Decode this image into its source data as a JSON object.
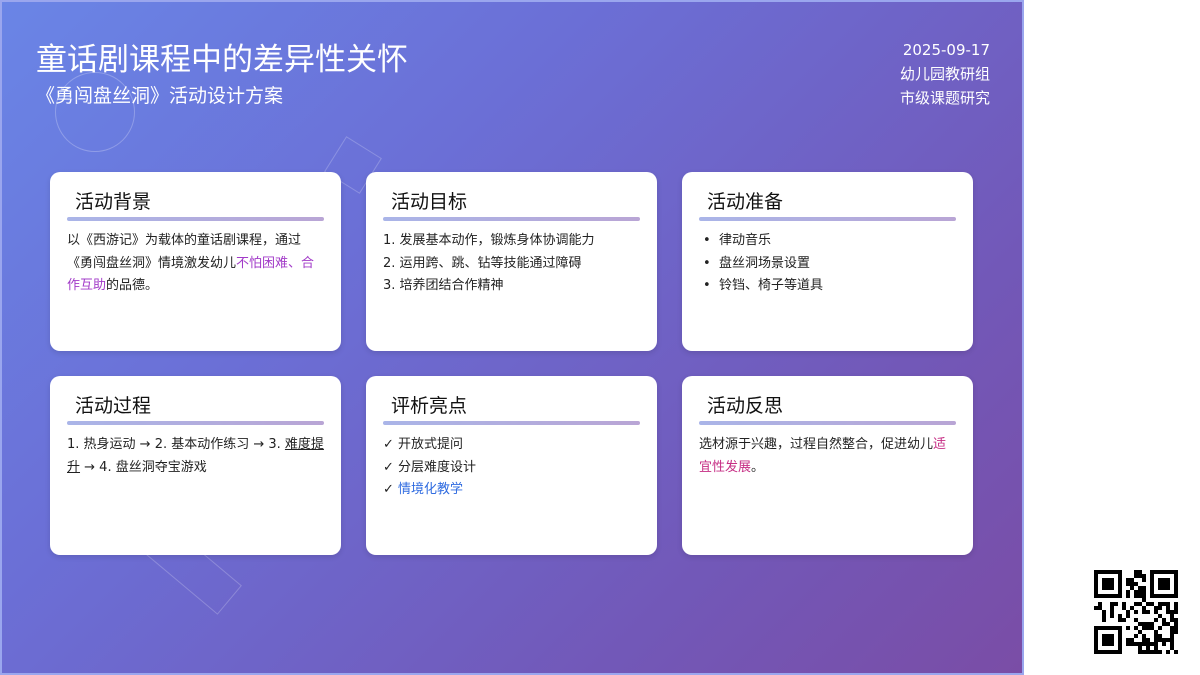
{
  "header": {
    "title": "童话剧课程中的差异性关怀",
    "subtitle": "《勇闯盘丝洞》活动设计方案",
    "date": "2025-09-17",
    "org": "幼儿园教研组",
    "project": "市级课题研究"
  },
  "cards": {
    "background": {
      "title": "活动背景",
      "text_a": "以《西游记》为载体的童话剧课程，通过《勇闯盘丝洞》情境激发幼儿",
      "text_hl": "不怕困难、合作互助",
      "text_b": "的品德。"
    },
    "goals": {
      "title": "活动目标",
      "items": [
        "1. 发展基本动作，锻炼身体协调能力",
        "2. 运用跨、跳、钻等技能通过障碍",
        "3. 培养团结合作精神"
      ]
    },
    "prep": {
      "title": "活动准备",
      "items": [
        "律动音乐",
        "盘丝洞场景设置",
        "铃铛、椅子等道具"
      ]
    },
    "process": {
      "title": "活动过程",
      "text_a": "1. 热身运动 → 2. 基本动作练习 → 3. ",
      "text_ul": "难度提升",
      "text_b": " → 4. 盘丝洞夺宝游戏"
    },
    "highlights": {
      "title": "评析亮点",
      "items": [
        "✓ 开放式提问",
        "✓ 分层难度设计"
      ],
      "item3_check": "✓ ",
      "item3_text": "情境化教学"
    },
    "reflection": {
      "title": "活动反思",
      "text_a": "选材源于兴趣，过程自然整合，促进幼儿",
      "text_hl": "适宜性发展",
      "text_b": "。"
    }
  },
  "qr_icon": "qr-code-icon"
}
